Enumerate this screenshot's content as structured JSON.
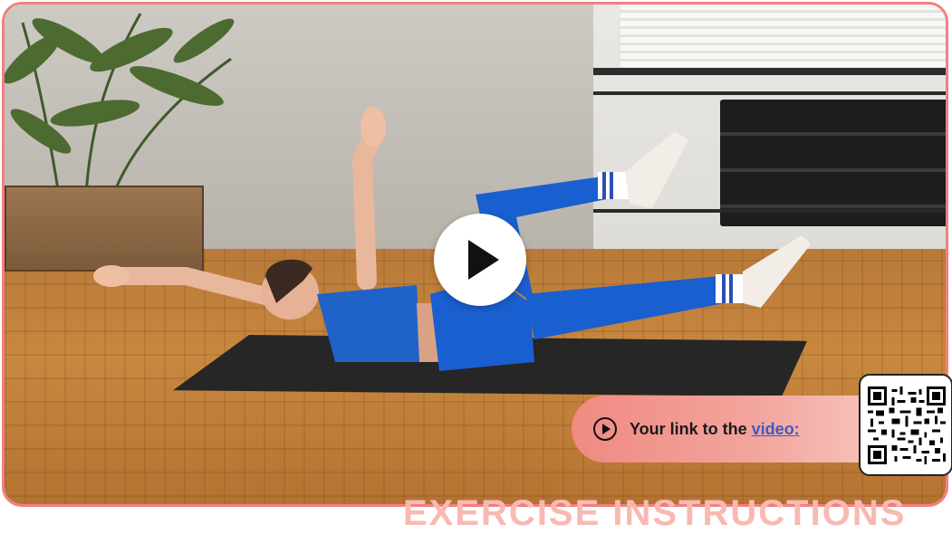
{
  "banner": {
    "text": "Your link to the",
    "link_label": "video:"
  },
  "bottom_text": "EXERCISE INSTRUCTIONS",
  "colors": {
    "border": "#f08080",
    "banner_start": "#f08a82",
    "link": "#3b5bc4"
  },
  "icons": {
    "play": "play-icon",
    "banner_play": "play-circle-icon",
    "qr": "qr-code-icon"
  }
}
